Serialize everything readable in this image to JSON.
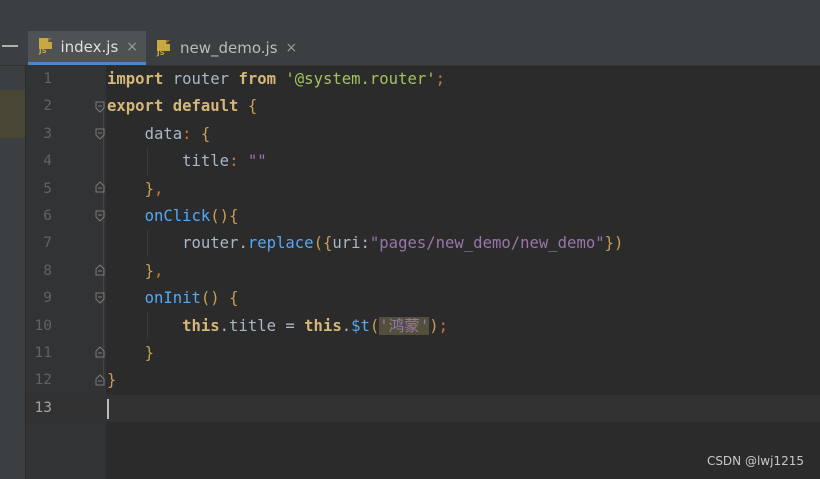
{
  "tabs": [
    {
      "label": "index.js",
      "active": true,
      "icon": "js-file-icon",
      "close": "×"
    },
    {
      "label": "new_demo.js",
      "active": false,
      "icon": "js-file-icon",
      "close": "×"
    }
  ],
  "file_icon_text": "JS",
  "line_numbers": [
    "1",
    "2",
    "3",
    "4",
    "5",
    "6",
    "7",
    "8",
    "9",
    "10",
    "11",
    "12",
    "13"
  ],
  "current_line": "13",
  "code": {
    "l1": {
      "import": "import",
      "router": " router ",
      "from": "from",
      "str": "'@system.router'",
      "semi": ";"
    },
    "l2": {
      "export": "export",
      "default": " default ",
      "brace": "{"
    },
    "l3": {
      "prop": "data",
      "colon": ": ",
      "brace": "{"
    },
    "l4": {
      "prop": "title",
      "colon": ": ",
      "str": "\"\""
    },
    "l5": {
      "brace": "}",
      "comma": ","
    },
    "l6": {
      "fn": "onClick",
      "paren": "()",
      "brace": "{"
    },
    "l7": {
      "obj": "router",
      "dot": ".",
      "method": "replace",
      "open": "(",
      "obrace": "{",
      "key": "uri",
      "colon": ":",
      "str": "\"pages/new_demo/new_demo\"",
      "cbrace": "}",
      "close": ")"
    },
    "l8": {
      "brace": "}",
      "comma": ","
    },
    "l9": {
      "fn": "onInit",
      "paren": "() ",
      "brace": "{"
    },
    "l10": {
      "this1": "this",
      "prop": ".title = ",
      "this2": "this",
      "dot": ".",
      "method": "$t",
      "open": "(",
      "str": "'鸿蒙'",
      "close": ")",
      "semi": ";"
    },
    "l11": {
      "brace": "}"
    },
    "l12": {
      "brace": "}"
    }
  },
  "watermark": "CSDN @lwj1215"
}
